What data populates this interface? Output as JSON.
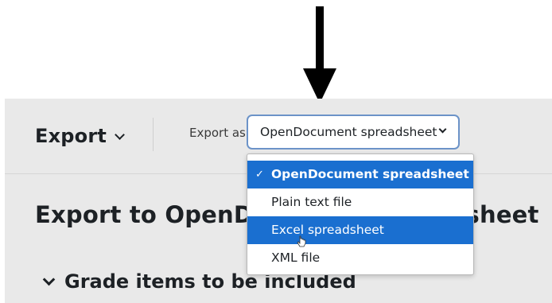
{
  "header": {
    "export_menu_label": "Export",
    "export_as_label": "Export as",
    "selected_format": "OpenDocument spreadsheet"
  },
  "main": {
    "heading": "Export to OpenDocument spreadsheet",
    "section_label": "Grade items to be included"
  },
  "dropdown": {
    "check_glyph": "✓",
    "options": [
      {
        "label": "OpenDocument spreadsheet",
        "selected": true
      },
      {
        "label": "Plain text file",
        "selected": false
      },
      {
        "label": "Excel spreadsheet",
        "selected": false,
        "hovered": true
      },
      {
        "label": "XML file",
        "selected": false
      }
    ]
  },
  "colors": {
    "accent": "#1a6fd0",
    "select_border": "#6c93c8",
    "panel_bg": "#e9e9e9"
  },
  "icons": {
    "annotation": "down-arrow-icon",
    "menu_chevron": "chevron-down-icon",
    "pointer": "hand-cursor-icon"
  }
}
